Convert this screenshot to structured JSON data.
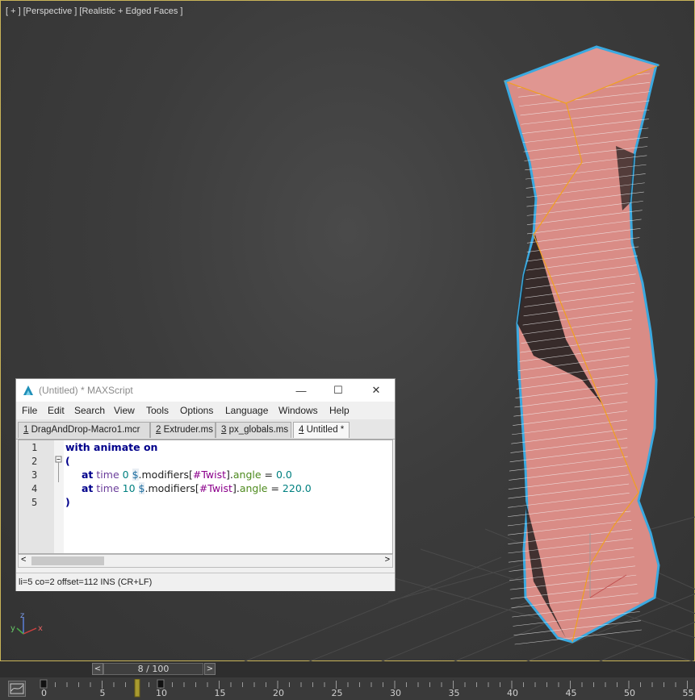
{
  "viewport": {
    "label": "[ + ] [Perspective ] [Realistic + Edged Faces ]",
    "axis_labels": {
      "x": "x",
      "y": "y",
      "z": "z"
    }
  },
  "maxscript": {
    "title": "(Untitled) * MAXScript",
    "window_controls": {
      "minimize": "—",
      "maximize": "☐",
      "close": "✕"
    },
    "menu": [
      "File",
      "Edit",
      "Search",
      "View",
      "Tools",
      "Options",
      "Language",
      "Windows",
      "Help"
    ],
    "tabs": [
      {
        "num": "1",
        "label": " DragAndDrop-Macro1.mcr"
      },
      {
        "num": "2",
        "label": " Extruder.ms"
      },
      {
        "num": "3",
        "label": " px_globals.ms"
      },
      {
        "num": "4",
        "label": " Untitled *"
      }
    ],
    "line_numbers": [
      "1",
      "2",
      "3",
      "4",
      "5"
    ],
    "code": {
      "line1": "with animate on",
      "line2": "(",
      "line3": {
        "at": "at",
        "time": "time",
        "t": "0",
        "dollar": "$",
        "mod": ".modifiers[",
        "name": "#Twist",
        "close": "].",
        "prop": "angle",
        "eq": " = ",
        "val": "0.0"
      },
      "line4": {
        "at": "at",
        "time": "time",
        "t": "10",
        "dollar": "$",
        "mod": ".modifiers[",
        "name": "#Twist",
        "close": "].",
        "prop": "angle",
        "eq": " = ",
        "val": "220.0"
      },
      "line5": ")"
    },
    "scroll_left": "<",
    "scroll_right": ">",
    "status": "li=5 co=2 offset=112 INS (CR+LF)"
  },
  "timeline": {
    "frame_display": "8 / 100",
    "prev": "<",
    "next": ">",
    "current_frame": 8,
    "ticks": [
      "0",
      "5",
      "10",
      "15",
      "20",
      "25",
      "30",
      "35",
      "40",
      "45",
      "50",
      "55"
    ]
  },
  "colors": {
    "object_fill": "#d98c86",
    "object_edge": "#f4f4f4",
    "selection_outline": "#3aa9e0",
    "accent_orange": "#f0a020"
  }
}
